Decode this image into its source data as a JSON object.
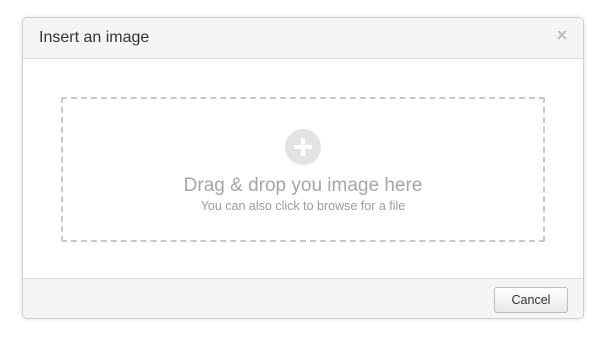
{
  "modal": {
    "title": "Insert an image",
    "close_icon": "close-icon",
    "close_glyph": "×"
  },
  "dropzone": {
    "icon": "plus-circle-icon",
    "title": "Drag & drop you image here",
    "subtitle": "You can also click to browse for a file"
  },
  "footer": {
    "cancel_label": "Cancel"
  },
  "colors": {
    "header_bg": "#f5f5f5",
    "border": "#dcdcdc",
    "dropzone_border": "#c8c8c8",
    "muted_text": "#a6a6a6"
  }
}
